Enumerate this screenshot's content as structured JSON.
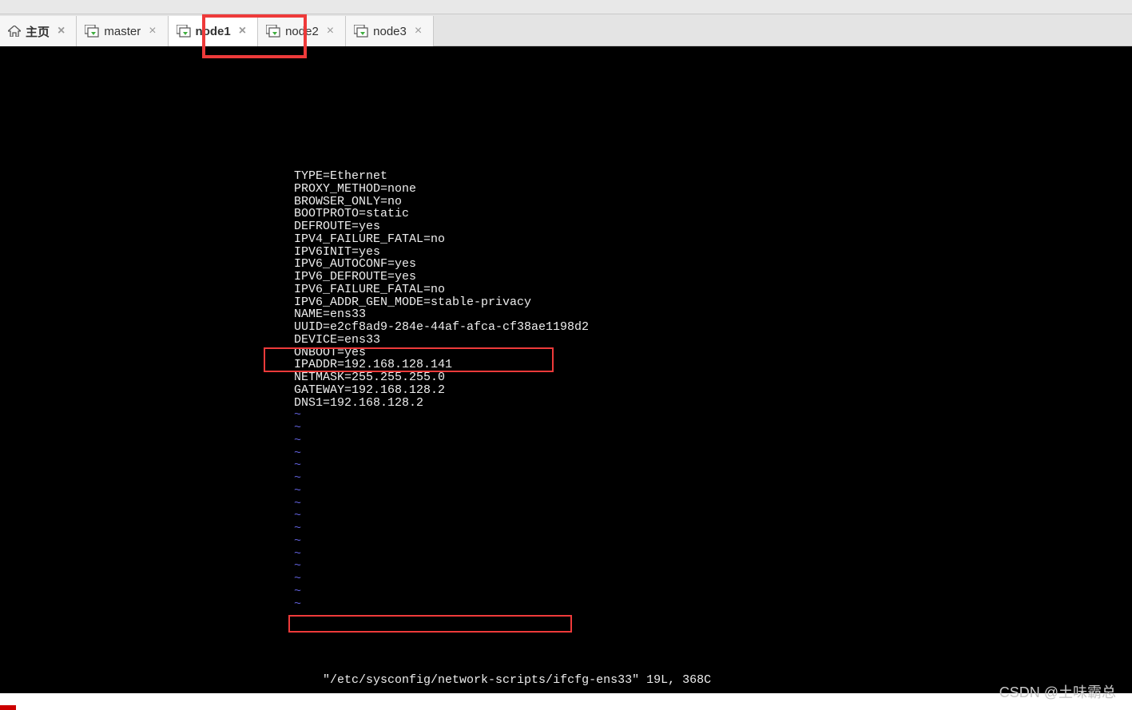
{
  "tabs": {
    "home": {
      "label": "主页"
    },
    "items": [
      {
        "label": "master"
      },
      {
        "label": "node1"
      },
      {
        "label": "node2"
      },
      {
        "label": "node3"
      }
    ],
    "close_glyph": "×"
  },
  "terminal": {
    "lines": [
      "TYPE=Ethernet",
      "PROXY_METHOD=none",
      "BROWSER_ONLY=no",
      "BOOTPROTO=static",
      "DEFROUTE=yes",
      "IPV4_FAILURE_FATAL=no",
      "IPV6INIT=yes",
      "IPV6_AUTOCONF=yes",
      "IPV6_DEFROUTE=yes",
      "IPV6_FAILURE_FATAL=no",
      "IPV6_ADDR_GEN_MODE=stable-privacy",
      "NAME=ens33",
      "UUID=e2cf8ad9-284e-44af-afca-cf38ae1198d2",
      "DEVICE=ens33",
      "ONBOOT=yes",
      "IPADDR=192.168.128.141",
      "NETMASK=255.255.255.0",
      "GATEWAY=192.168.128.2",
      "DNS1=192.168.128.2"
    ],
    "tilde_count": 16,
    "status_path": "\"/etc/sysconfig/network-scripts/ifcfg-ens33\"",
    "status_info": " 19L, 368C"
  },
  "watermark": "CSDN @土味霸总"
}
